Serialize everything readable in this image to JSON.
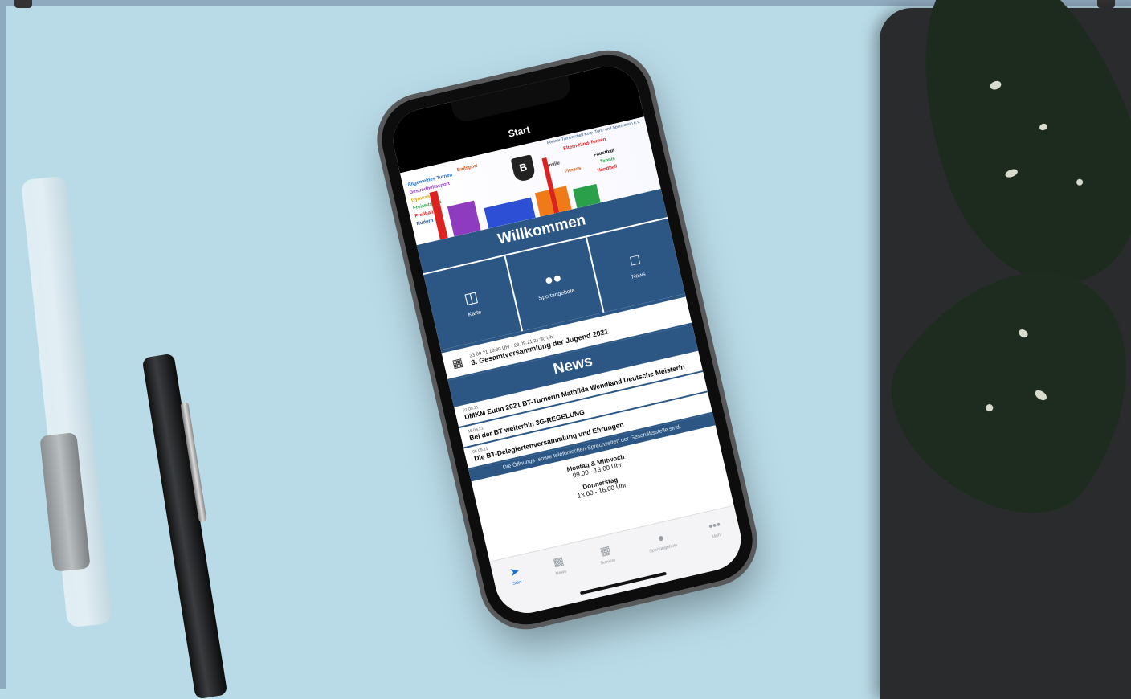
{
  "app": {
    "nav_title": "Start",
    "banner_club": "Berliner Turnerschaft Korp. Turn- und Sportverein e.V.",
    "banner_logo": "B",
    "banner_words": [
      "Allgemeines Turnen",
      "Ballsport",
      "Gesundheitssport",
      "Gymnastik",
      "Freizeitsport",
      "Prellball",
      "Rudern",
      "Eltern-Kind-Turnen",
      "Faustball",
      "Handball",
      "Tennis",
      "Familie",
      "Fitness"
    ],
    "welcome": "Willkommen",
    "tiles": [
      {
        "label": "Karte",
        "icon": "map-icon"
      },
      {
        "label": "Sportangebote",
        "icon": "users-icon"
      },
      {
        "label": "News",
        "icon": "chat-icon"
      }
    ],
    "event": {
      "time": "23.09.21 18:30 Uhr - 23.09.21 21:30 Uhr",
      "title": "3. Gesamtversammlung der Jugend 2021"
    },
    "news_heading": "News",
    "news": [
      {
        "date": "21.09.21",
        "title": "DMKM Eutin 2021 BT-Turnerin Mathilda Wendland Deutsche Meisterin"
      },
      {
        "date": "15.09.21",
        "title": "Bei der BT weiterhin 3G-REGELUNG"
      },
      {
        "date": "08.09.21",
        "title": "Die BT-Delegiertenversammlung und Ehrungen"
      }
    ],
    "info_text": "Die Öffnungs- sowie telefonischen Sprechzeiten der Geschäftsstelle sind:",
    "hours": [
      {
        "days": "Montag & Mittwoch",
        "time": "09.00 - 13.00 Uhr"
      },
      {
        "days": "Donnerstag",
        "time": "13.00 - 16.00 Uhr"
      }
    ],
    "tabbar": [
      {
        "label": "Start",
        "icon": "compass-icon",
        "active": true
      },
      {
        "label": "News",
        "icon": "news-icon",
        "active": false
      },
      {
        "label": "Termine",
        "icon": "calendar-icon",
        "active": false
      },
      {
        "label": "Sportangebote",
        "icon": "sports-icon",
        "active": false
      },
      {
        "label": "Mehr",
        "icon": "more-icon",
        "active": false
      }
    ],
    "accent_color": "#2c5784"
  }
}
